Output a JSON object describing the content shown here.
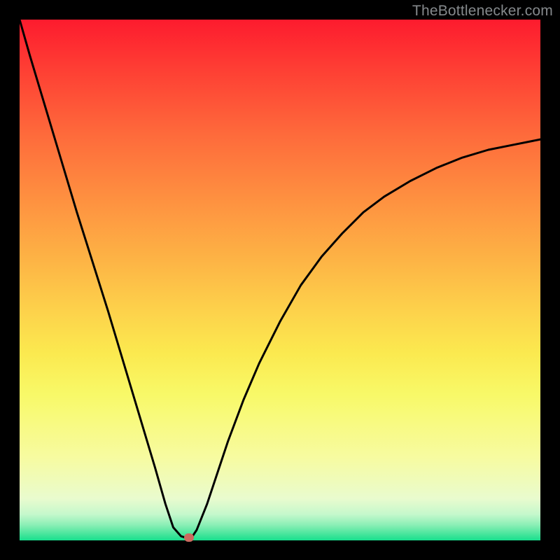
{
  "watermark": "TheBottlenecker.com",
  "chart_data": {
    "type": "line",
    "title": "",
    "xlabel": "",
    "ylabel": "",
    "xlim": [
      0,
      100
    ],
    "ylim": [
      0,
      100
    ],
    "x": [
      0,
      2,
      5,
      8,
      11,
      14,
      17,
      20,
      23,
      26,
      28,
      29.5,
      31,
      32,
      33,
      34,
      36,
      38,
      40,
      43,
      46,
      50,
      54,
      58,
      62,
      66,
      70,
      75,
      80,
      85,
      90,
      95,
      100
    ],
    "values": [
      100,
      93,
      83,
      73,
      63,
      53.5,
      44,
      34,
      24,
      14,
      7,
      2.5,
      0.8,
      0.5,
      0.5,
      2,
      7,
      13,
      19,
      27,
      34,
      42,
      49,
      54.5,
      59,
      63,
      66,
      69,
      71.5,
      73.5,
      75,
      76,
      77
    ],
    "marker": {
      "x": 32.5,
      "y": 0.5
    },
    "gradient_stops": [
      {
        "pct": 0,
        "color": "#fd1b2e"
      },
      {
        "pct": 50,
        "color": "#fed048"
      },
      {
        "pct": 80,
        "color": "#f7fa8a"
      },
      {
        "pct": 100,
        "color": "#18df8e"
      }
    ]
  }
}
